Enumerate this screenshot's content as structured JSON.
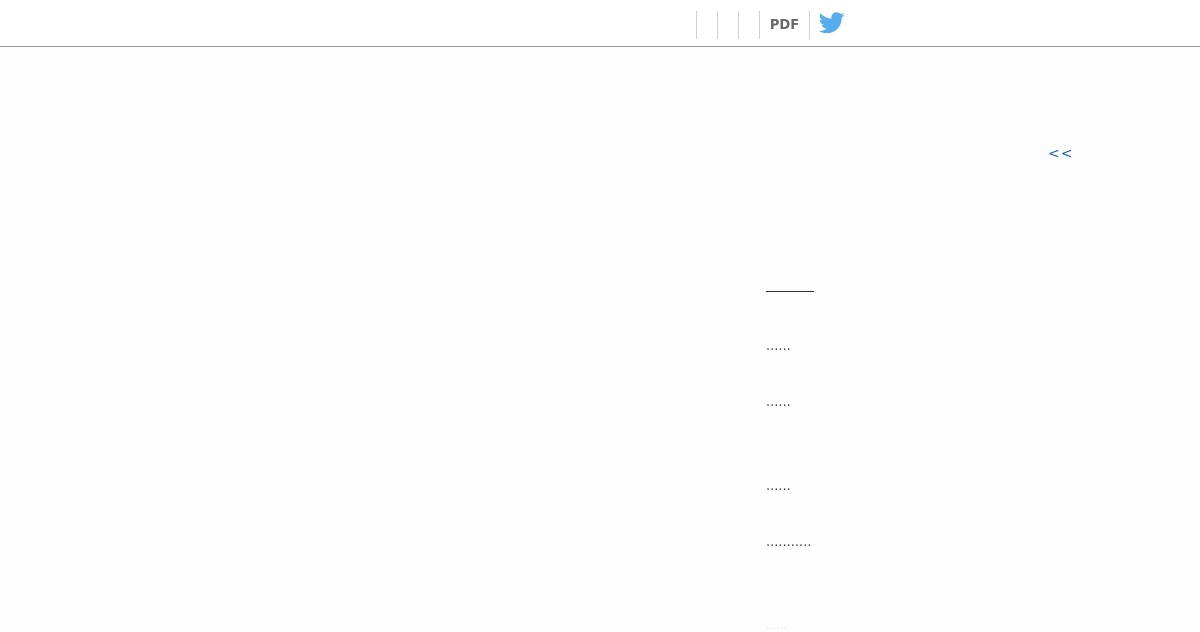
{
  "toolbar": {
    "pdf_label": "PDF",
    "twitter_icon": "twitter-bird-icon",
    "twitter_color": "#55acee"
  },
  "content": {
    "back_link": "<<",
    "dot_lines": [
      "......",
      "......",
      "......",
      "..........."
    ],
    "faint_text": "......"
  },
  "colors": {
    "link": "#1f5fa8",
    "divider": "#9a9a9a"
  }
}
